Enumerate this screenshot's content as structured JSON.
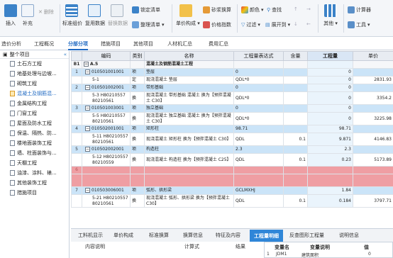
{
  "toolbar": {
    "insert": "插入",
    "supplement": "补充",
    "delete": "删除",
    "standard_group": "标准组价",
    "copy_data": "复用数据",
    "replace_data": "替换数据",
    "lock_list": "锁定清单",
    "organize_list": "整理清单",
    "unit_composition": "单价构成",
    "other_calc": "砂浆换算",
    "price_index": "价格指数",
    "color": "颜色",
    "find": "查找",
    "filter": "过滤",
    "expand_to": "展开到",
    "other": "其他",
    "calculator": "计算器",
    "tools": "工具"
  },
  "tabs": [
    "造价分析",
    "工程概况",
    "分部分项",
    "措施项目",
    "其他项目",
    "人材机汇总",
    "费用汇总"
  ],
  "active_tab_index": 2,
  "sidebar": {
    "header": "整个项目",
    "items": [
      "土石方工程",
      "地基处理与边坡...",
      "砌筑工程",
      "混凝土及钢筋混...",
      "金属结构工程",
      "门窗工程",
      "屋面及防水工程",
      "保温、隔热、防...",
      "楼地面装饰工程",
      "墙、柱面装饰与...",
      "天棚工程",
      "油漆、涂料、裱...",
      "其他装饰工程",
      "措施项目"
    ],
    "selected_index": 3
  },
  "grid": {
    "headers": [
      "",
      "编码",
      "类别",
      "名称",
      "工程量表达式",
      "含量",
      "工程量",
      "单价"
    ],
    "section": {
      "idx": "B1",
      "code": "A.5",
      "name": "混凝土及钢筋混凝土工程"
    },
    "rows": [
      {
        "kind": "blue",
        "idx": "1",
        "code": "010501001001",
        "type": "项",
        "name": "垫层",
        "expr": "0",
        "qty_content": "",
        "qty": "0",
        "price": ""
      },
      {
        "kind": "white",
        "idx": "",
        "code": "5-1",
        "type": "定",
        "name": "现浇混凝土 垫层",
        "expr": "QDL*0",
        "qty_content": "",
        "qty": "0",
        "price": "2831.93"
      },
      {
        "kind": "blue",
        "idx": "2",
        "code": "010501002001",
        "type": "项",
        "name": "带形基础",
        "expr": "0",
        "qty_content": "",
        "qty": "0",
        "price": ""
      },
      {
        "kind": "white2",
        "idx": "",
        "code": "5-3 H80210557 80210561",
        "type": "换",
        "name": "现浇混凝土 带形基础 混凝土 换为【预拌混凝土 C30】",
        "expr": "QDL*0",
        "qty_content": "",
        "qty": "0",
        "price": "3354.2"
      },
      {
        "kind": "blue",
        "idx": "3",
        "code": "010501003001",
        "type": "项",
        "name": "独立基础",
        "expr": "0",
        "qty_content": "",
        "qty": "0",
        "price": ""
      },
      {
        "kind": "white2",
        "idx": "",
        "code": "5-5 H80210557 80210561",
        "type": "换",
        "name": "现浇混凝土 独立基础 混凝土 换为【预拌混凝土 C30】",
        "expr": "QDL*0",
        "qty_content": "",
        "qty": "0",
        "price": "3225.98"
      },
      {
        "kind": "blue",
        "idx": "4",
        "code": "010502001001",
        "type": "项",
        "name": "矩形柱",
        "expr": "98.71",
        "qty_content": "",
        "qty": "98.71",
        "price": ""
      },
      {
        "kind": "white2",
        "idx": "",
        "code": "5-11 H80210557 80210561",
        "type": "换",
        "name": "现浇混凝土 矩形柱 换为【预拌混凝土 C30】",
        "expr": "QDL",
        "qty_content": "0.1",
        "qty": "9.871",
        "price": "4146.83"
      },
      {
        "kind": "blue",
        "idx": "5",
        "code": "010502002001",
        "type": "项",
        "name": "构造柱",
        "expr": "2.3",
        "qty_content": "",
        "qty": "2.3",
        "price": ""
      },
      {
        "kind": "white2",
        "idx": "",
        "code": "5-12 H80210557 80210559",
        "type": "换",
        "name": "现浇混凝土 构造柱 换为【预拌混凝土 C25】",
        "expr": "QDL",
        "qty_content": "0.1",
        "qty": "0.23",
        "price": "5173.89"
      },
      {
        "kind": "red",
        "idx": "6",
        "code": "",
        "type": "",
        "name": "",
        "expr": "",
        "qty_content": "",
        "qty": "",
        "price": ""
      },
      {
        "kind": "red2",
        "idx": "",
        "code": "",
        "type": "",
        "name": "",
        "expr": "",
        "qty_content": "",
        "qty": "",
        "price": ""
      },
      {
        "kind": "blue",
        "idx": "7",
        "code": "010503006001",
        "type": "项",
        "name": "弧形、拱形梁",
        "expr": "GCLMXHJ",
        "qty_content": "",
        "qty": "1.84",
        "price": ""
      },
      {
        "kind": "white2",
        "idx": "",
        "code": "5-21 H80210557 80210561",
        "type": "换",
        "name": "现浇混凝土 弧形、拱形梁 换为【预拌混凝土 C30】",
        "expr": "QDL",
        "qty_content": "0.1",
        "qty": "0.184",
        "price": "3797.71"
      }
    ]
  },
  "bottom_tabs": [
    "工料机显示",
    "单价构成",
    "标准换算",
    "换算信息",
    "特征及内容",
    "工程量明细",
    "反查图形工程量",
    "说明信息"
  ],
  "active_bottom_tab_index": 5,
  "detail": {
    "col1": "内容说明",
    "col2": "计算式",
    "col3": "结果"
  },
  "vars": {
    "col1": "变量名",
    "col2": "变量说明",
    "col3": "值",
    "row_idx": "1",
    "row_name": "JDM1",
    "row_desc": "建筑面积",
    "row_val": "0"
  }
}
